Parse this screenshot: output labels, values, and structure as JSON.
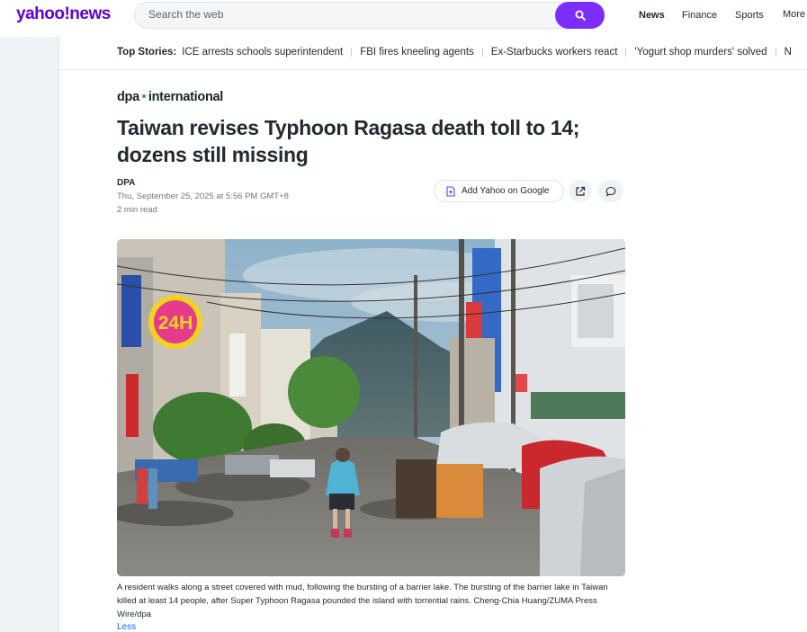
{
  "header": {
    "logo": "yahoo!news",
    "search_placeholder": "Search the web",
    "nav": [
      "News",
      "Finance",
      "Sports",
      "More"
    ]
  },
  "top_stories": {
    "label": "Top Stories:",
    "items": [
      "ICE arrests schools superintendent",
      "FBI fires kneeling agents",
      "Ex-Starbucks workers react",
      "'Yogurt shop murders' solved",
      "N"
    ]
  },
  "article": {
    "brand_left": "dpa",
    "brand_right": "international",
    "headline": "Taiwan revises Typhoon Ragasa death toll to 14; dozens still missing",
    "author": "DPA",
    "date": "Thu, September 25, 2025 at 5:56 PM GMT+8",
    "read_time": "2 min read",
    "add_google_label": "Add Yahoo on Google",
    "photo_sign": "24H",
    "caption": "A resident walks along a street covered with mud, following the bursting of a barrier lake. The bursting of the barrier lake in Taiwan killed at least 14 people, after Super Typhoon Ragasa pounded the island with torrential rains. Cheng-Chia Huang/ZUMA Press Wire/dpa",
    "less_label": "Less"
  },
  "colors": {
    "brand_purple": "#5f01d1",
    "search_button": "#7d2eff",
    "link_blue": "#0f69ff"
  }
}
